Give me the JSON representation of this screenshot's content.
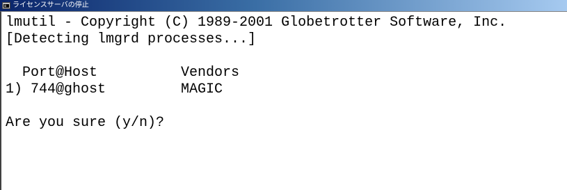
{
  "window": {
    "title": "ライセンスサーバの停止",
    "icon": "console-window-icon"
  },
  "console": {
    "lines": [
      "lmutil - Copyright (C) 1989-2001 Globetrotter Software, Inc.",
      "[Detecting lmgrd processes...]",
      "",
      "  Port@Host          Vendors",
      "1) 744@ghost         MAGIC",
      "",
      "Are you sure (y/n)?"
    ]
  }
}
